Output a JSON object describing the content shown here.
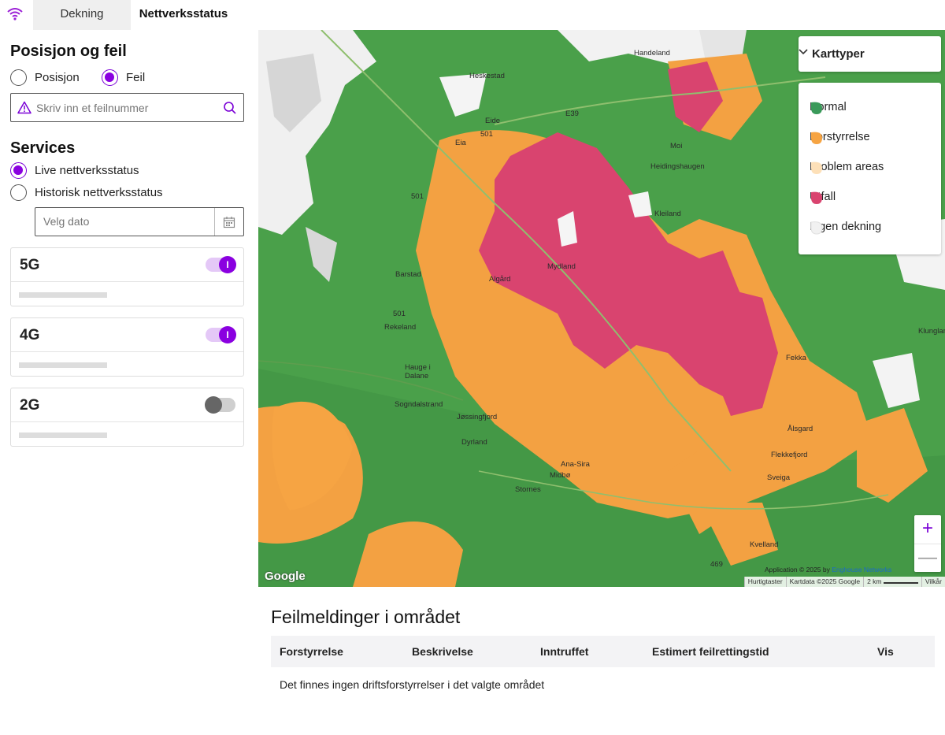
{
  "tabs": [
    {
      "label": "Dekning",
      "active": true
    },
    {
      "label": "Nettverksstatus",
      "active": false
    }
  ],
  "sidebar": {
    "section1_title": "Posisjon og feil",
    "radio_position": "Posisjon",
    "radio_error": "Feil",
    "search_placeholder": "Skriv inn et feilnummer",
    "section2_title": "Services",
    "radio_live": "Live nettverksstatus",
    "radio_history": "Historisk nettverksstatus",
    "date_placeholder": "Velg dato",
    "networks": [
      {
        "label": "5G",
        "enabled": true,
        "toggle_text": "I"
      },
      {
        "label": "4G",
        "enabled": true,
        "toggle_text": "I"
      },
      {
        "label": "2G",
        "enabled": false,
        "toggle_text": ""
      }
    ]
  },
  "map": {
    "map_type_label": "Karttyper",
    "legend": [
      {
        "label": "Normal",
        "color": "#3a9a5a"
      },
      {
        "label": "Forstyrrelse",
        "color": "#f6a443"
      },
      {
        "label": "Problem areas",
        "color": "#fde0b8"
      },
      {
        "label": "Utfall",
        "color": "#d9446f"
      },
      {
        "label": "Ingen dekning",
        "color": "#f1f1f1"
      }
    ],
    "place_names": [
      "Handeland",
      "Heskestad",
      "Eide",
      "Eia",
      "Moi",
      "Heidingshaugen",
      "Barstad",
      "Algård",
      "Mydland",
      "Rekeland",
      "Hauge i Dalane",
      "Sogndalstrand",
      "Jøssingfjord",
      "Dyrland",
      "Ana-Sira",
      "Midbø",
      "Stornes",
      "Flekkefjord",
      "Sveiga",
      "Kvelland",
      "Kleiland",
      "Fekka",
      "Ålsgard",
      "Klungland"
    ],
    "road_labels": [
      "501",
      "501",
      "E39",
      "501",
      "469"
    ],
    "google_logo": "Google",
    "attribution_app": "Application © 2025 by",
    "attribution_link": "Enghouse Networks",
    "attribution_keys": "Hurtigtaster",
    "attribution_data": "Kartdata ©2025 Google",
    "attribution_scale": "2 km",
    "attribution_terms": "Vilkår",
    "zoom_in": "+",
    "zoom_out": "—"
  },
  "errors": {
    "title": "Feilmeldinger i området",
    "columns": [
      "Forstyrrelse",
      "Beskrivelse",
      "Inntruffet",
      "Estimert feilrettingstid",
      "Vis"
    ],
    "empty_message": "Det finnes ingen driftsforstyrrelser i det valgte området"
  },
  "colors": {
    "accent": "#8a00e0",
    "coverage_green": "#4aa04a",
    "outage": "#d9446f",
    "interference": "#f6a443"
  }
}
